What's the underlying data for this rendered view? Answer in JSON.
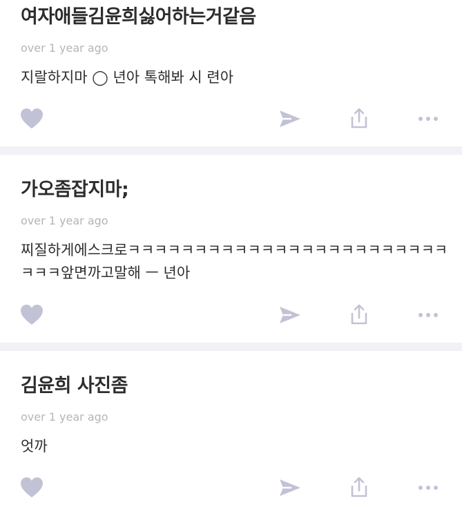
{
  "posts": [
    {
      "title": "여자애들김윤희싫어하는거같음",
      "time": "over 1 year ago",
      "body": "지랄하지마 ◯ 년아 톡해봐 시 련아"
    },
    {
      "title": "가오좀잡지마;",
      "time": "over 1 year ago",
      "body": "찌질하게에스크로ㅋㅋㅋㅋㅋㅋㅋㅋㅋㅋㅋㅋㅋㅋㅋㅋㅋㅋㅋㅋㅋㅋㅋㅋㅋㅋㅋ앞면까고말해 ㅡ 년아"
    },
    {
      "title": "김윤희 사진좀",
      "time": "over 1 year ago",
      "body": "엇까"
    }
  ],
  "icons": {
    "like": "heart-icon",
    "send": "send-icon",
    "share": "share-icon",
    "more": "more-icon"
  },
  "colors": {
    "icon": "#c2c2d6",
    "divider": "#f1f1f6",
    "meta": "#b5b5b5"
  }
}
